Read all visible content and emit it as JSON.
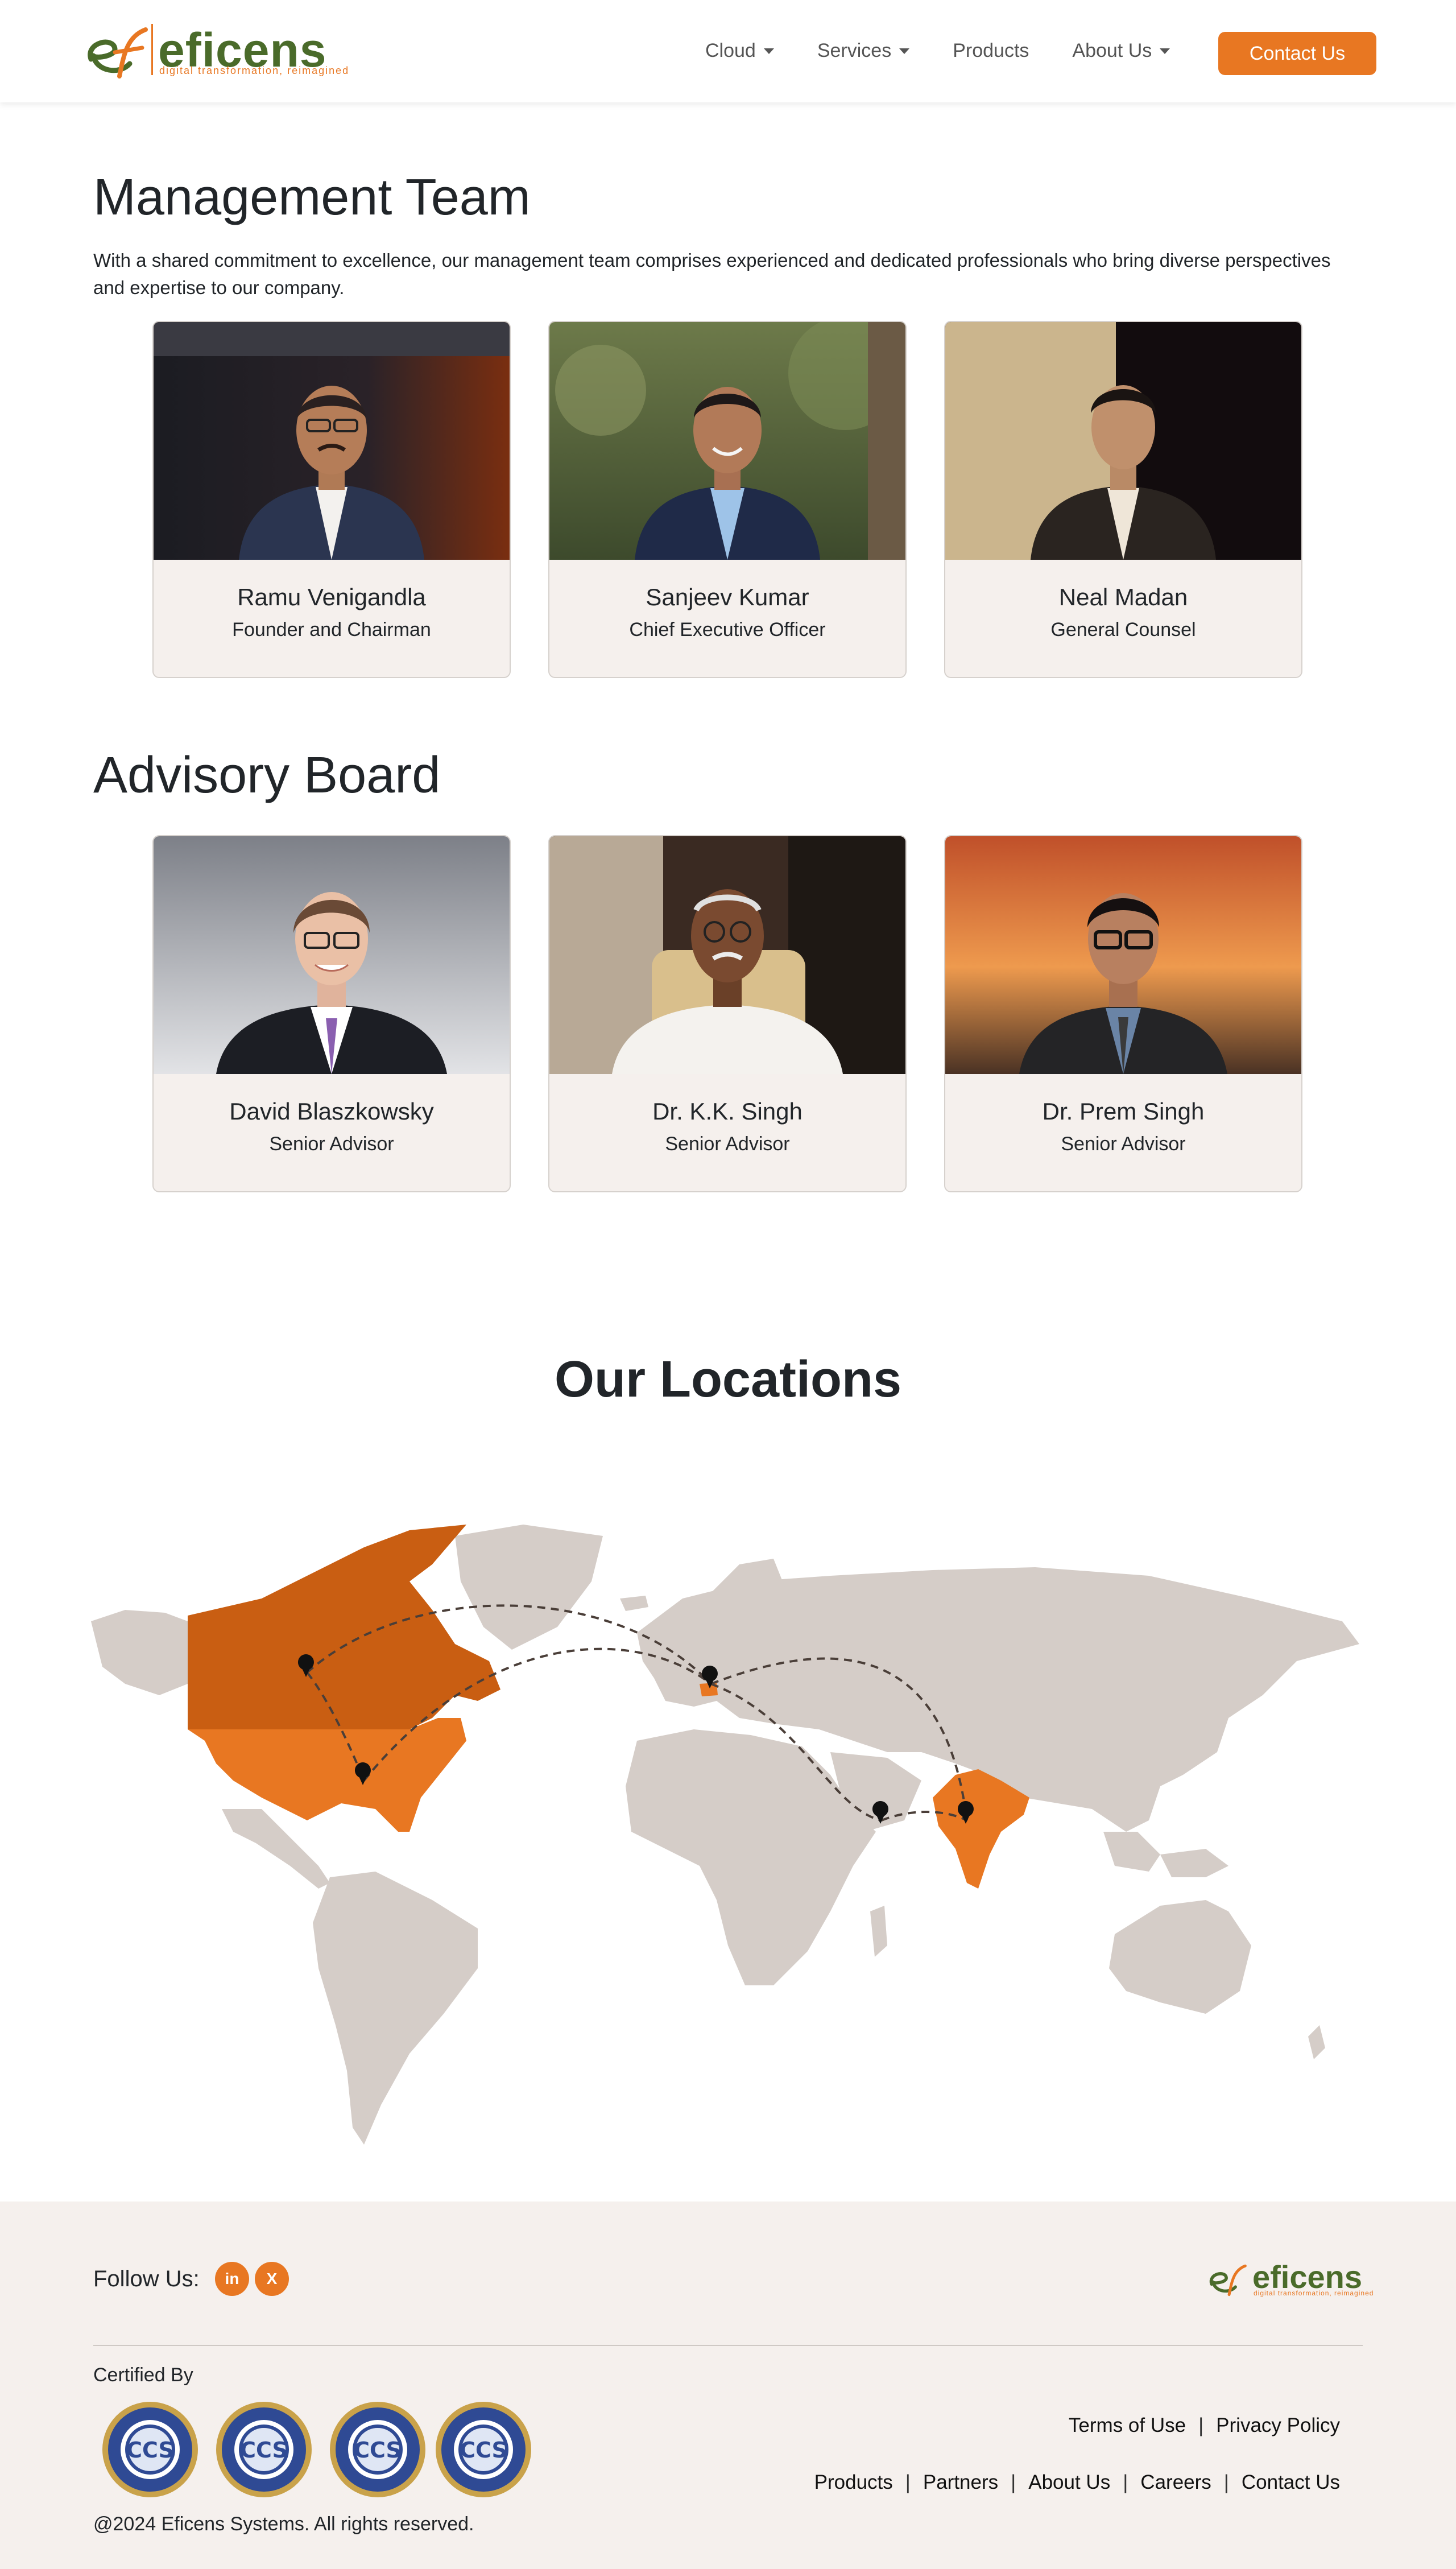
{
  "brand": {
    "name": "eficens",
    "tagline": "digital transformation, reimagined",
    "accent": "#e87722",
    "green": "#4a6b2a"
  },
  "nav": {
    "items": [
      {
        "label": "Cloud",
        "dropdown": true
      },
      {
        "label": "Services",
        "dropdown": true
      },
      {
        "label": "Products",
        "dropdown": false
      },
      {
        "label": "About Us",
        "dropdown": true
      }
    ],
    "cta": "Contact Us"
  },
  "management": {
    "title": "Management Team",
    "intro": "With a shared commitment to excellence, our management team comprises experienced and dedicated professionals who bring diverse perspectives and expertise to our company.",
    "members": [
      {
        "name": "Ramu Venigandla",
        "role": "Founder and Chairman"
      },
      {
        "name": "Sanjeev Kumar",
        "role": "Chief Executive Officer"
      },
      {
        "name": "Neal Madan",
        "role": "General Counsel"
      }
    ]
  },
  "advisory": {
    "title": "Advisory Board",
    "members": [
      {
        "name": "David Blaszkowsky",
        "role": "Senior Advisor"
      },
      {
        "name": "Dr. K.K. Singh",
        "role": "Senior Advisor"
      },
      {
        "name": "Dr. Prem Singh",
        "role": "Senior Advisor"
      }
    ]
  },
  "locations": {
    "title": "Our Locations"
  },
  "footer": {
    "follow_label": "Follow Us:",
    "social": [
      {
        "label": "in",
        "icon": "linkedin-icon"
      },
      {
        "label": "X",
        "icon": "x-icon"
      }
    ],
    "certified_label": "Certified By",
    "badge_text": "CCS",
    "copyright": "@2024 Eficens Systems. All rights reserved.",
    "links_row1": [
      "Terms of Use",
      "Privacy Policy"
    ],
    "links_row2": [
      "Products",
      "Partners",
      "About Us",
      "Careers",
      "Contact Us"
    ]
  }
}
